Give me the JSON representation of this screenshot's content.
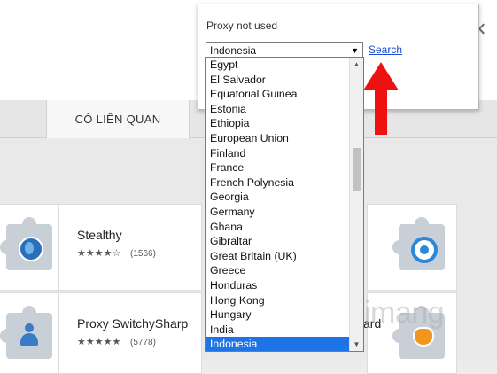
{
  "background": {
    "tab_active_label": "CÓ LIÊN QUAN",
    "extensions": [
      {
        "name": "Stealthy",
        "stars": "★★★★☆",
        "count": "(1566)"
      },
      {
        "name": "Proxy SwitchySharp",
        "stars": "★★★★★",
        "count": "(5778)"
      }
    ],
    "partial_right_text": "ard",
    "watermark": "uantrimang"
  },
  "popup": {
    "status": "Proxy not used",
    "selected_country": "Indonesia",
    "search_label": "Search"
  },
  "dropdown": {
    "options": [
      "Egypt",
      "El Salvador",
      "Equatorial Guinea",
      "Estonia",
      "Ethiopia",
      "European Union",
      "Finland",
      "France",
      "French Polynesia",
      "Georgia",
      "Germany",
      "Ghana",
      "Gibraltar",
      "Great Britain (UK)",
      "Greece",
      "Honduras",
      "Hong Kong",
      "Hungary",
      "India",
      "Indonesia"
    ],
    "highlighted": "Indonesia"
  },
  "icons": {
    "dropdown_arrow": "▼",
    "scroll_up": "▲",
    "scroll_down": "▼"
  },
  "colors": {
    "highlight": "#1e73e6",
    "link": "#1a4bd6",
    "arrow": "#ee1111"
  }
}
